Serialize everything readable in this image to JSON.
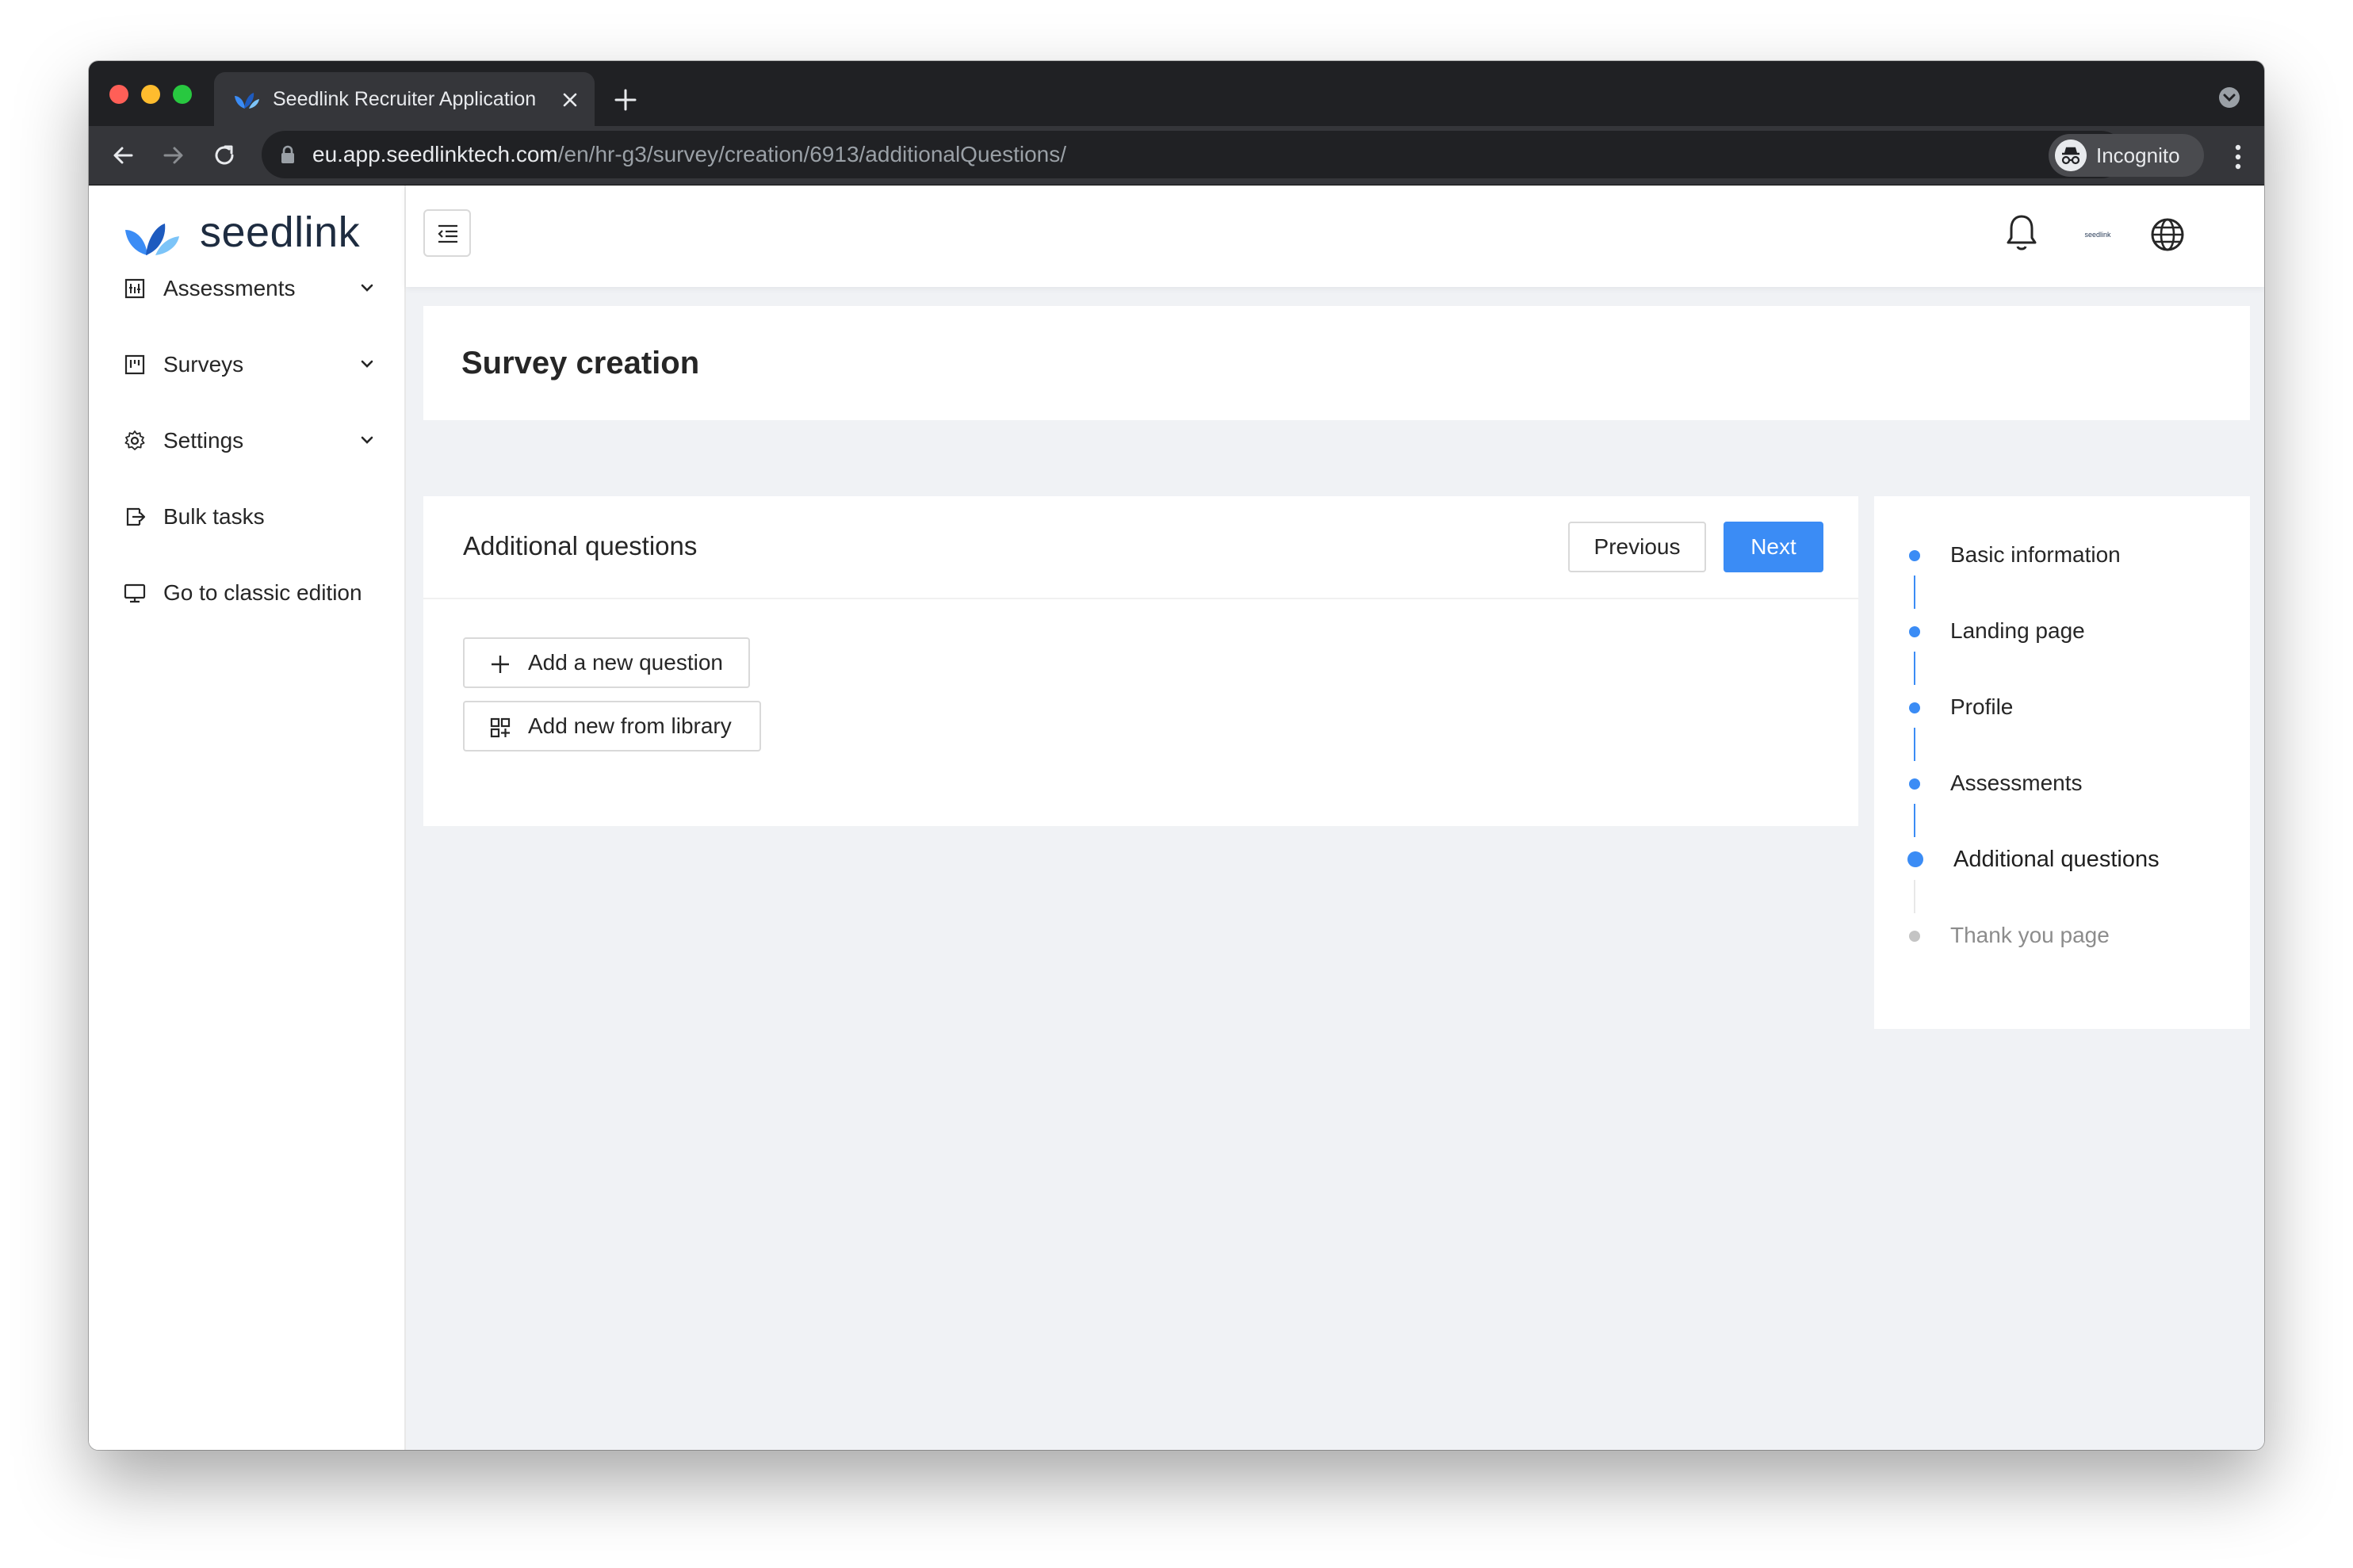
{
  "browser": {
    "tab_title": "Seedlink Recruiter Application",
    "url_host": "eu.app.seedlinktech.com",
    "url_path": "/en/hr-g3/survey/creation/6913/additionalQuestions/",
    "incognito_label": "Incognito"
  },
  "sidebar": {
    "logo_text": "seedlink",
    "items": [
      {
        "label": "Assessments",
        "icon": "assessments-icon",
        "expandable": true
      },
      {
        "label": "Surveys",
        "icon": "surveys-icon",
        "expandable": true
      },
      {
        "label": "Settings",
        "icon": "gear-icon",
        "expandable": true
      },
      {
        "label": "Bulk tasks",
        "icon": "bulk-tasks-icon",
        "expandable": false
      },
      {
        "label": "Go to classic edition",
        "icon": "monitor-icon",
        "expandable": false
      }
    ]
  },
  "header": {
    "company_logo_text": "seedlink"
  },
  "page": {
    "title": "Survey creation"
  },
  "section": {
    "title": "Additional questions",
    "previous_label": "Previous",
    "next_label": "Next",
    "add_question_label": "Add a new question",
    "add_library_label": "Add new from library"
  },
  "steps": [
    {
      "label": "Basic information",
      "state": "done"
    },
    {
      "label": "Landing page",
      "state": "done"
    },
    {
      "label": "Profile",
      "state": "done"
    },
    {
      "label": "Assessments",
      "state": "done"
    },
    {
      "label": "Additional questions",
      "state": "current"
    },
    {
      "label": "Thank you page",
      "state": "pending"
    }
  ],
  "colors": {
    "primary": "#3b8cf5",
    "background": "#f0f2f5",
    "chrome_dark": "#202124"
  }
}
